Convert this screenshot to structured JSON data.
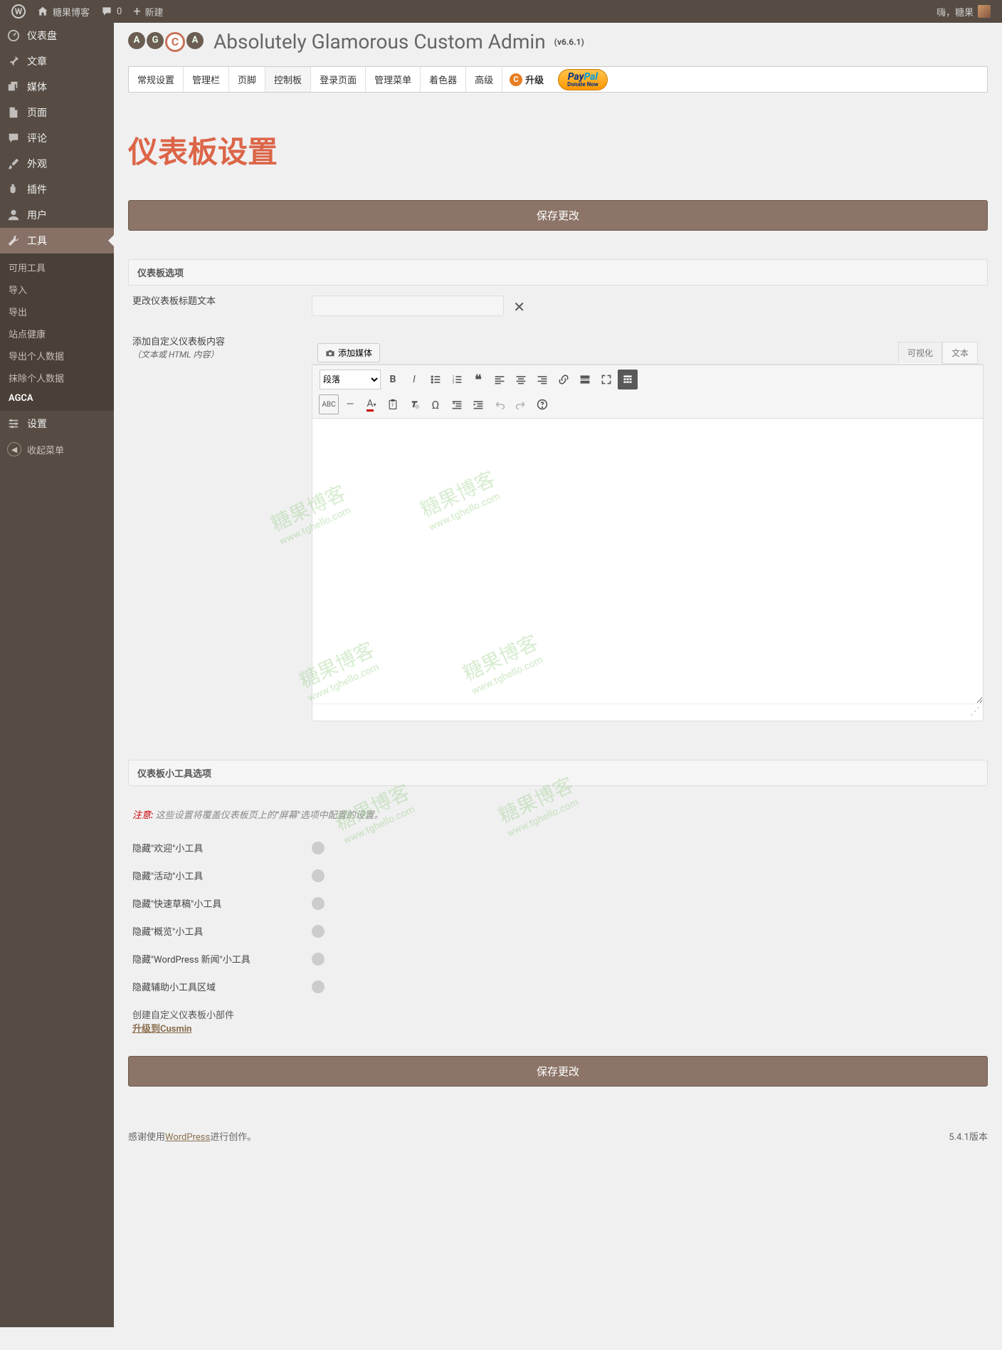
{
  "adminbar": {
    "site_name": "糖果博客",
    "comments_count": "0",
    "new_label": "新建",
    "greeting": "嗨，糖果"
  },
  "sidebar": {
    "dashboard": "仪表盘",
    "posts": "文章",
    "media": "媒体",
    "pages": "页面",
    "comments": "评论",
    "appearance": "外观",
    "plugins": "插件",
    "users": "用户",
    "tools": "工具",
    "tools_sub": {
      "available": "可用工具",
      "import": "导入",
      "export": "导出",
      "site_health": "站点健康",
      "export_personal": "导出个人数据",
      "erase_personal": "抹除个人数据",
      "agca": "AGCA"
    },
    "settings": "设置",
    "collapse": "收起菜单"
  },
  "header": {
    "title": "Absolutely Glamorous Custom Admin",
    "version": "(v6.6.1)"
  },
  "tabs": {
    "general": "常规设置",
    "adminbar": "管理栏",
    "footer": "页脚",
    "dashboard": "控制板",
    "login": "登录页面",
    "adminmenu": "管理菜单",
    "colorizer": "着色器",
    "advanced": "高级",
    "upgrade": "升级"
  },
  "paypal": {
    "pay": "Pay",
    "pal": "Pal",
    "sub": "Donate Now"
  },
  "page": {
    "title": "仪表板设置",
    "save_btn": "保存更改",
    "section_dashboard": "仪表板选项",
    "section_widgets": "仪表板小工具选项",
    "heading_label": "更改仪表板标题文本",
    "custom_content_label": "添加自定义仪表板内容",
    "custom_content_sub": "（文本或 HTML 内容）",
    "add_media": "添加媒体",
    "visual_tab": "可视化",
    "text_tab": "文本",
    "format_select": "段落",
    "notice_lead": "注意:",
    "notice_text": "这些设置将覆盖仪表板页上的\"屏幕\"选项中配置的设置。",
    "widgets": {
      "welcome": "隐藏\"欢迎\"小工具",
      "activity": "隐藏\"活动\"小工具",
      "quickdraft": "隐藏\"快速草稿\"小工具",
      "ataglance": "隐藏\"概览\"小工具",
      "wpnews": "隐藏\"WordPress 新闻\"小工具",
      "secondary": "隐藏辅助小工具区域"
    },
    "create_widget_label": "创建自定义仪表板小部件",
    "upgrade_cusmin": "升级到Cusmin"
  },
  "footer": {
    "thanks_pre": "感谢使用",
    "wp": "WordPress",
    "thanks_post": "进行创作。",
    "version": "5.4.1版本"
  },
  "watermark": {
    "big": "糖果博客",
    "sub": "www.tghello.com"
  }
}
